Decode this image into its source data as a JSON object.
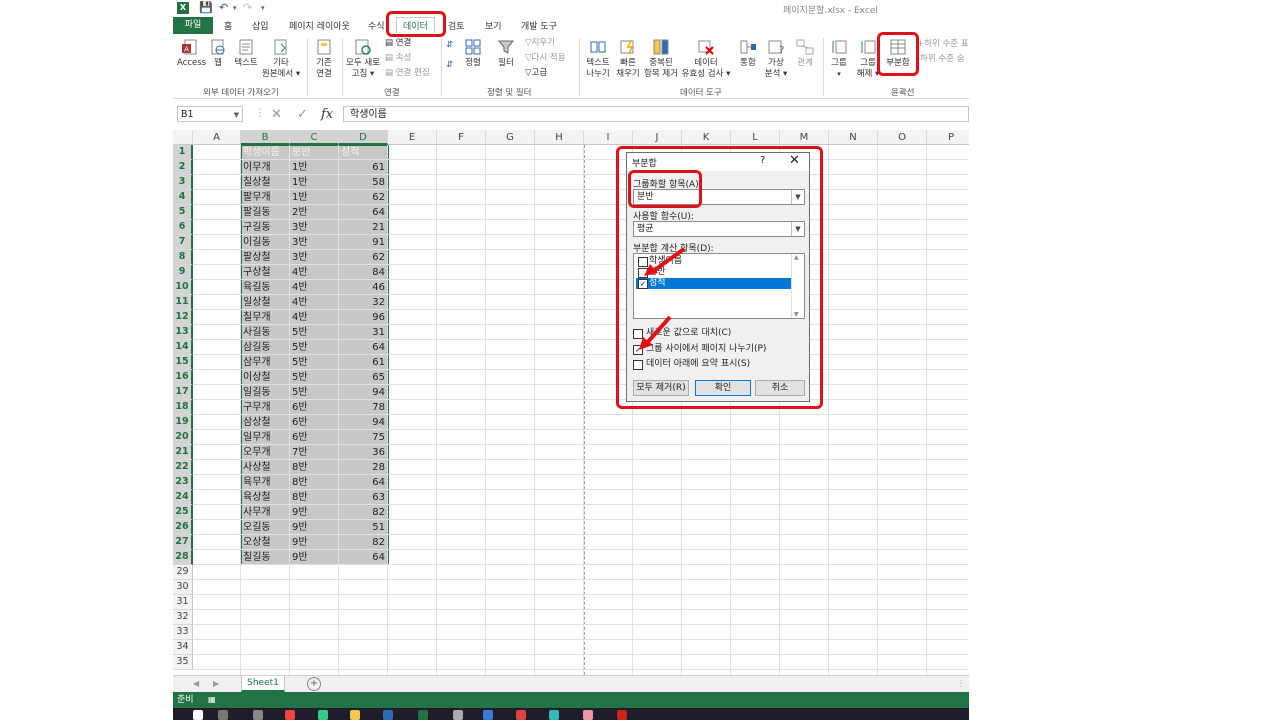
{
  "window": {
    "title": "페이지분할.xlsx - Excel",
    "app_badge": "X"
  },
  "ribbon_tabs": [
    "파일",
    "홈",
    "삽입",
    "페이지 레이아웃",
    "수식",
    "데이터",
    "검토",
    "보기",
    "개발 도구"
  ],
  "active_tab": "데이터",
  "ribbon": {
    "access": "Access",
    "web": "웹",
    "text": "텍스트",
    "other_l1": "기타",
    "other_l2": "원본에서 ▾",
    "existing_l1": "기존",
    "existing_l2": "연결",
    "refresh_l1": "모두 새로",
    "refresh_l2": "고침 ▾",
    "conn": "연결",
    "props": "속성",
    "edit_links": "연결 편집",
    "sort": "정렬",
    "filter": "필터",
    "clear": "지우기",
    "reapply": "다시 적용",
    "advanced": "고급",
    "text_to_cols_l1": "텍스트",
    "text_to_cols_l2": "나누기",
    "flash_l1": "빠른",
    "flash_l2": "채우기",
    "dup_l1": "중복된",
    "dup_l2": "항목 제거",
    "valid_l1": "데이터",
    "valid_l2": "유효성 검사 ▾",
    "consolidate": "통합",
    "whatif_l1": "가상",
    "whatif_l2": "분석 ▾",
    "relations": "관계",
    "group": "그룹",
    "ungroup_l1": "그룹",
    "ungroup_l2": "해제 ▾",
    "subtotal": "부분합",
    "show_detail": "하위 수준 표",
    "hide_detail": "하위 수준 숨",
    "groups": {
      "external": "외부 데이터 가져오기",
      "connections": "연결",
      "sortfilter": "정렬 및 필터",
      "tools": "데이터 도구",
      "outline": "윤곽선"
    }
  },
  "formula_bar": {
    "name_box": "B1",
    "content": "학생이름",
    "fx": "fx"
  },
  "columns": [
    "A",
    "B",
    "C",
    "D",
    "E",
    "F",
    "G",
    "H",
    "I",
    "J",
    "K",
    "L",
    "M",
    "N",
    "O",
    "P"
  ],
  "rows": [
    "1",
    "2",
    "3",
    "4",
    "5",
    "6",
    "7",
    "8",
    "9",
    "10",
    "11",
    "12",
    "13",
    "14",
    "15",
    "16",
    "17",
    "18",
    "19",
    "20",
    "21",
    "22",
    "23",
    "24",
    "25",
    "26",
    "27",
    "28",
    "29",
    "30",
    "31",
    "32",
    "33",
    "34",
    "35"
  ],
  "table": {
    "headers": [
      "학생이름",
      "분반",
      "성적"
    ],
    "data": [
      [
        "이무개",
        "1반",
        "61"
      ],
      [
        "칠상철",
        "1반",
        "58"
      ],
      [
        "팔무개",
        "1반",
        "62"
      ],
      [
        "팔길동",
        "2반",
        "64"
      ],
      [
        "구길동",
        "3반",
        "21"
      ],
      [
        "이길동",
        "3반",
        "91"
      ],
      [
        "팔상철",
        "3반",
        "62"
      ],
      [
        "구상철",
        "4반",
        "84"
      ],
      [
        "육길동",
        "4반",
        "46"
      ],
      [
        "일상철",
        "4반",
        "32"
      ],
      [
        "칠무개",
        "4반",
        "96"
      ],
      [
        "사길동",
        "5반",
        "31"
      ],
      [
        "삼길동",
        "5반",
        "64"
      ],
      [
        "삼무개",
        "5반",
        "61"
      ],
      [
        "이상철",
        "5반",
        "65"
      ],
      [
        "일길동",
        "5반",
        "94"
      ],
      [
        "구무개",
        "6반",
        "78"
      ],
      [
        "삼상철",
        "6반",
        "94"
      ],
      [
        "일무개",
        "6반",
        "75"
      ],
      [
        "오무개",
        "7반",
        "36"
      ],
      [
        "사상철",
        "8반",
        "28"
      ],
      [
        "육무개",
        "8반",
        "64"
      ],
      [
        "육상철",
        "8반",
        "63"
      ],
      [
        "사무개",
        "9반",
        "82"
      ],
      [
        "오길동",
        "9반",
        "51"
      ],
      [
        "오상철",
        "9반",
        "82"
      ],
      [
        "칠길동",
        "9반",
        "64"
      ]
    ]
  },
  "sheet_tab": "Sheet1",
  "status": "준비",
  "dialog": {
    "title": "부분합",
    "help": "?",
    "close": "✕",
    "group_by_label": "그룹화할 항목(A):",
    "group_by_value": "분반",
    "function_label": "사용할 함수(U):",
    "function_value": "평균",
    "add_to_label": "부분합 계산 항목(D):",
    "add_to": [
      {
        "label": "학생이름",
        "checked": false
      },
      {
        "label": "분반",
        "checked": false
      },
      {
        "label": "성적",
        "checked": true
      }
    ],
    "opt_replace": "새로운 값으로 대치(C)",
    "opt_pagebreak": "그룹 사이에서 페이지 나누기(P)",
    "opt_summary": "데이터 아래에 요약 표시(S)",
    "opt_replace_checked": false,
    "opt_pagebreak_checked": true,
    "opt_summary_checked": false,
    "btn_remove": "모두 제거(R)",
    "btn_ok": "확인",
    "btn_cancel": "취소"
  },
  "colors": {
    "excel_green": "#217346",
    "highlight_red": "#e0101a",
    "selection_blue": "#0078d7"
  }
}
